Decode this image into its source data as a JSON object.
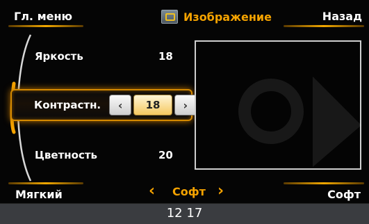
{
  "header": {
    "menu_label": "Гл. меню",
    "title": "Изображение",
    "title_icon": "image-settings-icon",
    "back_label": "Назад"
  },
  "settings": [
    {
      "label": "Яркость",
      "value": "18"
    },
    {
      "label": "Контрастн.",
      "value": "18",
      "selected": true
    },
    {
      "label": "Цветность",
      "value": "20"
    }
  ],
  "stepper": {
    "decrease_glyph": "‹",
    "increase_glyph": "›"
  },
  "footer": {
    "left_label": "Мягкий",
    "mode_label": "Софт",
    "right_label": "Софт",
    "prev_glyph": "‹",
    "next_glyph": "›"
  },
  "status": {
    "clock": "12 17"
  },
  "colors": {
    "accent": "#f5a300",
    "background": "#050505",
    "status_bar": "#3a3c40"
  }
}
